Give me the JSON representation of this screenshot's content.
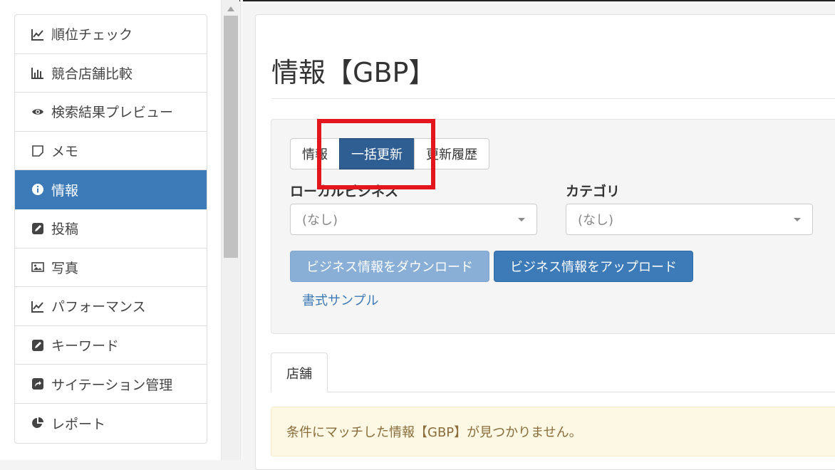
{
  "sidebar": {
    "items": [
      {
        "label": "順位チェック",
        "icon": "line-chart-icon",
        "active": false
      },
      {
        "label": "競合店舗比較",
        "icon": "bar-chart-icon",
        "active": false
      },
      {
        "label": "検索結果プレビュー",
        "icon": "eye-icon",
        "active": false
      },
      {
        "label": "メモ",
        "icon": "sticky-note-icon",
        "active": false
      },
      {
        "label": "情報",
        "icon": "info-circle-icon",
        "active": true
      },
      {
        "label": "投稿",
        "icon": "edit-icon",
        "active": false
      },
      {
        "label": "写真",
        "icon": "image-icon",
        "active": false
      },
      {
        "label": "パフォーマンス",
        "icon": "line-chart-icon",
        "active": false
      },
      {
        "label": "キーワード",
        "icon": "edit-icon",
        "active": false
      },
      {
        "label": "サイテーション管理",
        "icon": "share-icon",
        "active": false
      },
      {
        "label": "レポート",
        "icon": "pie-chart-icon",
        "active": false
      }
    ]
  },
  "main": {
    "title": "情報【GBP】",
    "view_tabs": [
      {
        "label": "情報",
        "active": false
      },
      {
        "label": "一括更新",
        "active": true
      },
      {
        "label": "更新履歴",
        "active": false
      }
    ],
    "filters": {
      "local_business_label": "ローカルビジネス",
      "local_business_value": "(なし)",
      "category_label": "カテゴリ",
      "category_value": "(なし)"
    },
    "buttons": {
      "download": "ビジネス情報をダウンロード",
      "upload": "ビジネス情報をアップロード"
    },
    "sample_link": "書式サンプル",
    "content_tab": "店舗",
    "alert_message": "条件にマッチした情報【GBP】が見つかりません。"
  },
  "colors": {
    "accent": "#3d7ab8",
    "active_segment": "#2f5e92",
    "download_button": "#8aafd6",
    "alert_bg": "#fcf8e3",
    "alert_text": "#8a6d3b",
    "highlight": "#e4161d"
  }
}
